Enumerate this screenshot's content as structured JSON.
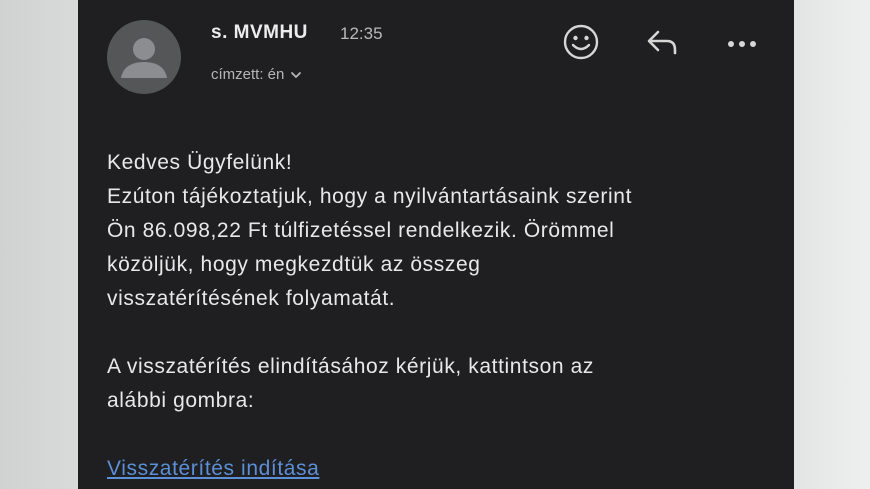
{
  "email": {
    "sender": "s. MVMHU",
    "time": "12:35",
    "recipient_label": "címzett: én",
    "actions": {
      "react_icon": "smiley-icon",
      "reply_icon": "reply-arrow-icon",
      "more_icon": "more-horizontal-icon"
    },
    "body": {
      "greeting": "Kedves Ügyfelünk!",
      "line1": "Ezúton tájékoztatjuk, hogy a nyilvántartásaink szerint",
      "line2": "Ön 86.098,22 Ft túlfizetéssel rendelkezik. Örömmel",
      "line3": "közöljük, hogy megkezdtük az összeg",
      "line4": "visszatérítésének folyamatát.",
      "line5": "A visszatérítés elindításához kérjük, kattintson az",
      "line6": "alábbi gombra:",
      "link_text": "Visszatérítés indítása"
    }
  },
  "colors": {
    "background": "#1f1f21",
    "text": "#e8e8e8",
    "link": "#5b8fd6",
    "avatar": "#555658"
  }
}
